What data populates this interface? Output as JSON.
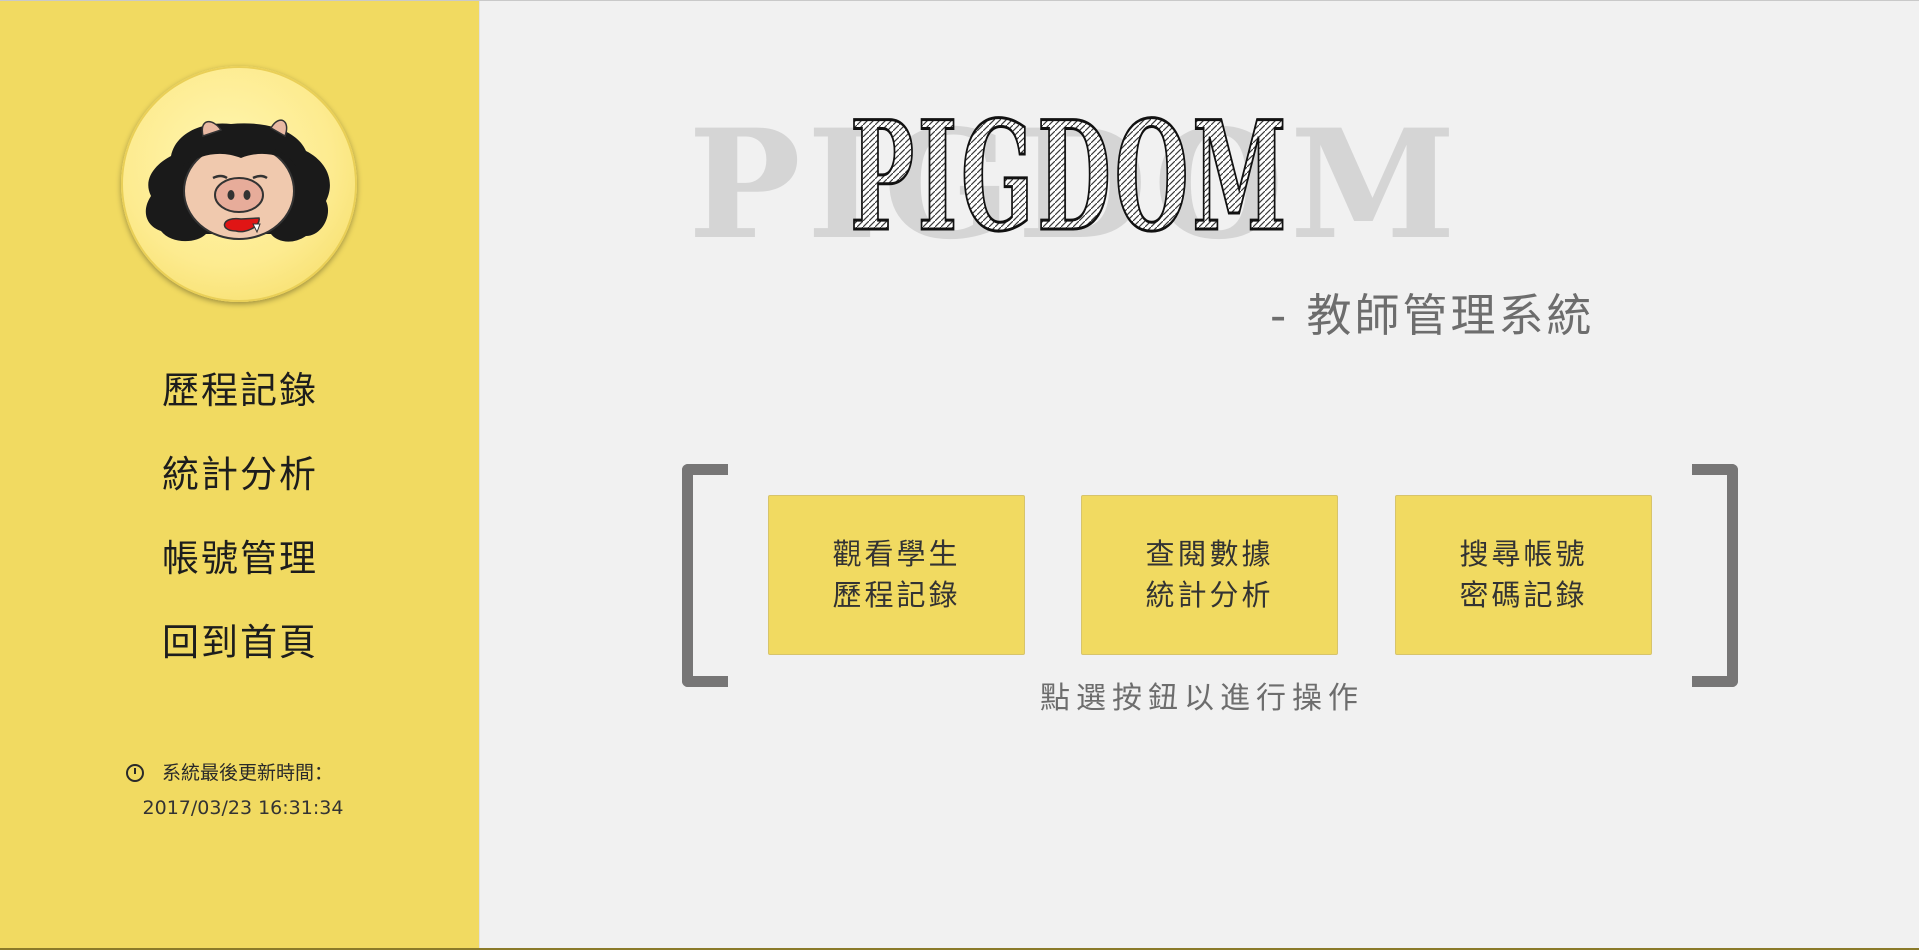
{
  "app": {
    "logo_text": "PIGDOM",
    "subtitle": "- 教師管理系統"
  },
  "sidebar": {
    "avatar": "pig-mascot-avatar",
    "items": [
      {
        "label": "歷程記錄"
      },
      {
        "label": "統計分析"
      },
      {
        "label": "帳號管理"
      },
      {
        "label": "回到首頁"
      }
    ],
    "update": {
      "icon": "clock-icon",
      "label": "系統最後更新時間：",
      "time": "2017/03/23 16:31:34"
    }
  },
  "main": {
    "actions": [
      {
        "line1": "觀看學生",
        "line2": "歷程記錄"
      },
      {
        "line1": "查閱數據",
        "line2": "統計分析"
      },
      {
        "line1": "搜尋帳號",
        "line2": "密碼記錄"
      }
    ],
    "hint": "點選按鈕以進行操作"
  },
  "colors": {
    "sidebar_bg": "#f1da61",
    "page_bg": "#f1f1f1",
    "button_bg": "#f1da61",
    "bracket": "#777676",
    "subtitle_text": "#6d6d6d"
  }
}
